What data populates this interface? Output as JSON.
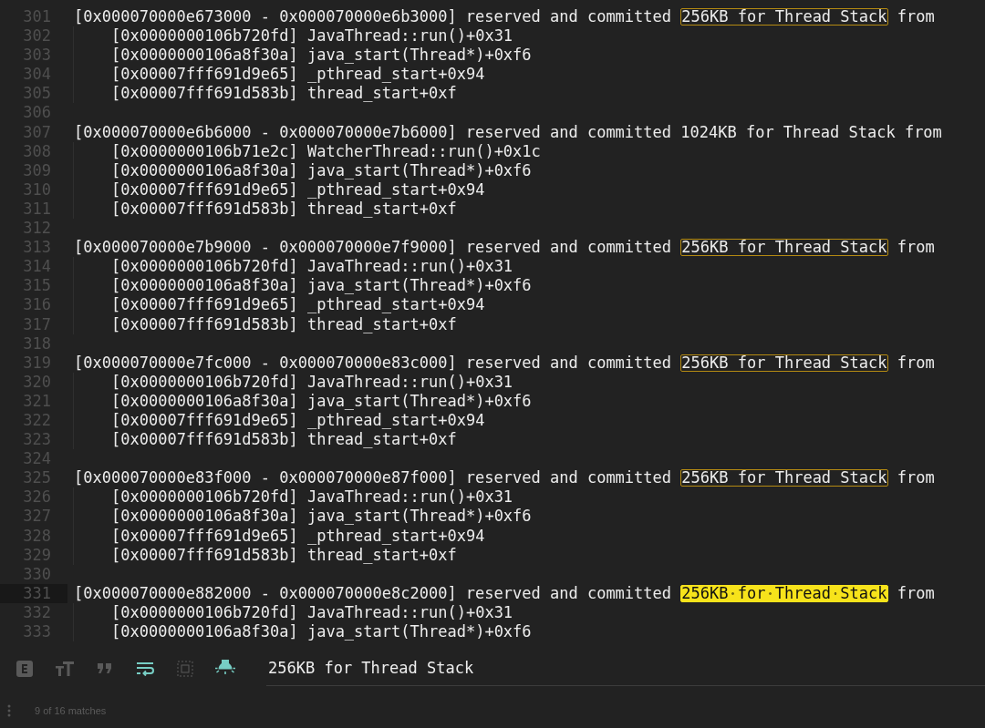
{
  "editor": {
    "lines": [
      {
        "number": "301",
        "kind": "header",
        "prefix": "[0x000070000e673000 - 0x000070000e6b3000] reserved and committed ",
        "match": "256KB for Thread Stack",
        "suffix": " from",
        "current": false
      },
      {
        "number": "302",
        "kind": "frame",
        "text": "[0x0000000106b720fd] JavaThread::run()+0x31"
      },
      {
        "number": "303",
        "kind": "frame",
        "text": "[0x0000000106a8f30a] java_start(Thread*)+0xf6"
      },
      {
        "number": "304",
        "kind": "frame",
        "text": "[0x00007fff691d9e65] _pthread_start+0x94"
      },
      {
        "number": "305",
        "kind": "frame",
        "text": "[0x00007fff691d583b] thread_start+0xf"
      },
      {
        "number": "306",
        "kind": "blank"
      },
      {
        "number": "307",
        "kind": "header",
        "prefix": "[0x000070000e6b6000 - 0x000070000e7b6000] reserved and committed 1024KB for Thread Stack from"
      },
      {
        "number": "308",
        "kind": "frame",
        "text": "[0x0000000106b71e2c] WatcherThread::run()+0x1c"
      },
      {
        "number": "309",
        "kind": "frame",
        "text": "[0x0000000106a8f30a] java_start(Thread*)+0xf6"
      },
      {
        "number": "310",
        "kind": "frame",
        "text": "[0x00007fff691d9e65] _pthread_start+0x94"
      },
      {
        "number": "311",
        "kind": "frame",
        "text": "[0x00007fff691d583b] thread_start+0xf"
      },
      {
        "number": "312",
        "kind": "blank"
      },
      {
        "number": "313",
        "kind": "header",
        "prefix": "[0x000070000e7b9000 - 0x000070000e7f9000] reserved and committed ",
        "match": "256KB for Thread Stack",
        "suffix": " from",
        "current": false
      },
      {
        "number": "314",
        "kind": "frame",
        "text": "[0x0000000106b720fd] JavaThread::run()+0x31"
      },
      {
        "number": "315",
        "kind": "frame",
        "text": "[0x0000000106a8f30a] java_start(Thread*)+0xf6"
      },
      {
        "number": "316",
        "kind": "frame",
        "text": "[0x00007fff691d9e65] _pthread_start+0x94"
      },
      {
        "number": "317",
        "kind": "frame",
        "text": "[0x00007fff691d583b] thread_start+0xf"
      },
      {
        "number": "318",
        "kind": "blank"
      },
      {
        "number": "319",
        "kind": "header",
        "prefix": "[0x000070000e7fc000 - 0x000070000e83c000] reserved and committed ",
        "match": "256KB for Thread Stack",
        "suffix": " from",
        "current": false
      },
      {
        "number": "320",
        "kind": "frame",
        "text": "[0x0000000106b720fd] JavaThread::run()+0x31"
      },
      {
        "number": "321",
        "kind": "frame",
        "text": "[0x0000000106a8f30a] java_start(Thread*)+0xf6"
      },
      {
        "number": "322",
        "kind": "frame",
        "text": "[0x00007fff691d9e65] _pthread_start+0x94"
      },
      {
        "number": "323",
        "kind": "frame",
        "text": "[0x00007fff691d583b] thread_start+0xf"
      },
      {
        "number": "324",
        "kind": "blank"
      },
      {
        "number": "325",
        "kind": "header",
        "prefix": "[0x000070000e83f000 - 0x000070000e87f000] reserved and committed ",
        "match": "256KB for Thread Stack",
        "suffix": " from",
        "current": false
      },
      {
        "number": "326",
        "kind": "frame",
        "text": "[0x0000000106b720fd] JavaThread::run()+0x31"
      },
      {
        "number": "327",
        "kind": "frame",
        "text": "[0x0000000106a8f30a] java_start(Thread*)+0xf6"
      },
      {
        "number": "328",
        "kind": "frame",
        "text": "[0x00007fff691d9e65] _pthread_start+0x94"
      },
      {
        "number": "329",
        "kind": "frame",
        "text": "[0x00007fff691d583b] thread_start+0xf"
      },
      {
        "number": "330",
        "kind": "blank"
      },
      {
        "number": "331",
        "kind": "header",
        "prefix": "[0x000070000e882000 - 0x000070000e8c2000] reserved and committed ",
        "match": "256KB for Thread Stack",
        "suffix": " from",
        "current": true
      },
      {
        "number": "332",
        "kind": "frame",
        "text": "[0x0000000106b720fd] JavaThread::run()+0x31"
      },
      {
        "number": "333",
        "kind": "frame",
        "text": "[0x0000000106a8f30a] java_start(Thread*)+0xf6"
      }
    ]
  },
  "find_bar": {
    "toggles": [
      {
        "kind": "regex",
        "on": false
      },
      {
        "kind": "case",
        "on": false
      },
      {
        "kind": "word",
        "on": false
      },
      {
        "kind": "wrap",
        "on": true
      },
      {
        "kind": "selection",
        "on": false
      },
      {
        "kind": "highlight",
        "on": true
      }
    ],
    "query": "256KB for Thread Stack"
  },
  "status_bar": {
    "matches": "9 of 16 matches"
  }
}
